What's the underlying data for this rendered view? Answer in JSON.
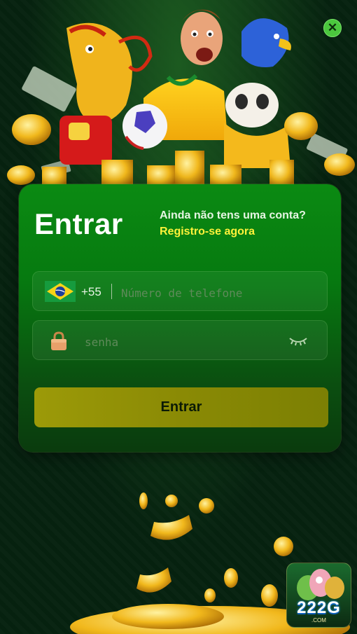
{
  "header": {
    "close_icon": "close-icon"
  },
  "login": {
    "title": "Entrar",
    "no_account_text": "Ainda não tens uma conta?",
    "register_link": "Registro-se agora",
    "phone": {
      "country_code": "+55",
      "placeholder": "Número de telefone",
      "flag_icon": "brazil-flag-icon"
    },
    "password": {
      "placeholder": "senha",
      "lock_icon": "lock-icon",
      "toggle_icon": "eye-closed-icon"
    },
    "submit_label": "Entrar"
  },
  "brand": {
    "logo_number": "222G",
    "logo_suffix": ".COM"
  },
  "colors": {
    "accent_yellow": "#fff23a",
    "card_green": "#067a10",
    "button_olive": "#8a8a05",
    "close_green": "#4bc73e"
  }
}
